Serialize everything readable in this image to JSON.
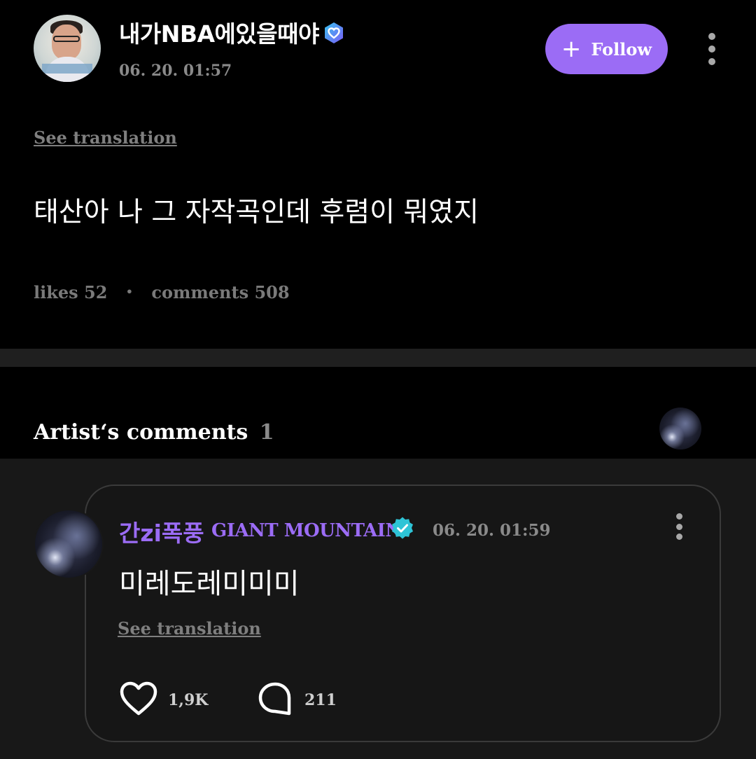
{
  "post": {
    "author_name": "내가NBA에있을때야",
    "timestamp": "06. 20. 01:57",
    "follow_label": "Follow",
    "see_translation": "See translation",
    "text": "태산아 나 그 자작곡인데 후렴이 뭐였지",
    "likes_label": "likes",
    "likes_count": "52",
    "comments_label": "comments",
    "comments_count": "508"
  },
  "artist_comments": {
    "title": "Artist‘s comments",
    "count": "1"
  },
  "comment": {
    "name": "간zi폭풍",
    "group": "GIANT MOUNTAIN",
    "timestamp": "06. 20. 01:59",
    "text": "미레도레미미미",
    "see_translation": "See translation",
    "like_count": "1,9K",
    "reply_count": "211"
  },
  "colors": {
    "accent": "#9b6cf5",
    "background": "#000000",
    "card_background": "#161616",
    "muted_text": "#8a8a8a",
    "verified_teal": "#2ec4d6"
  },
  "icons": {
    "post_badge": "verified-heart-badge-icon",
    "follow": "plus-icon",
    "more": "more-vertical-icon",
    "artist_badge": "verified-check-badge-icon",
    "like": "heart-icon",
    "reply": "chat-bubble-icon"
  }
}
